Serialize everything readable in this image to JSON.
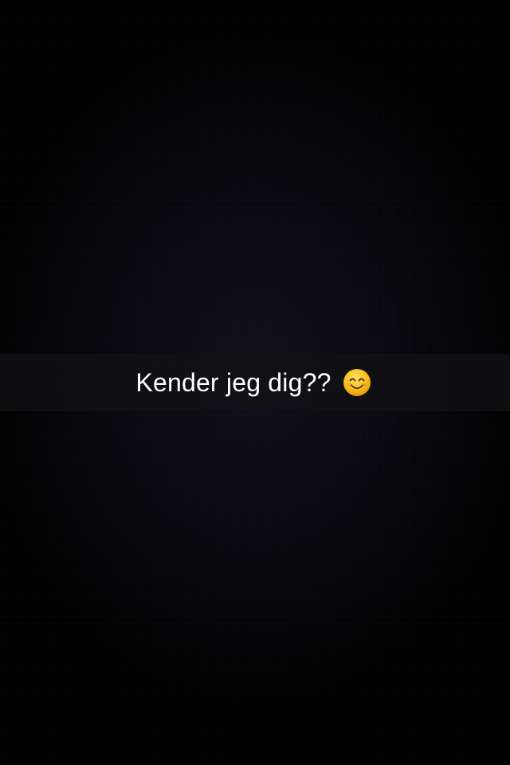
{
  "caption": {
    "text": "Kender jeg dig??",
    "emoji": "smiling-face-with-smiling-eyes-icon"
  },
  "colors": {
    "background": "#000000",
    "caption_bar": "#121214",
    "caption_text": "#ffffff",
    "emoji_face": "#f9c21b"
  }
}
